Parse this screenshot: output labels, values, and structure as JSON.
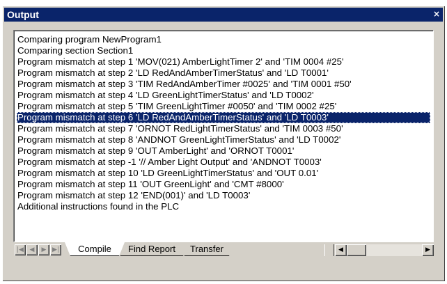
{
  "window": {
    "title": "Output",
    "close_glyph": "×"
  },
  "output": {
    "lines": [
      "Comparing program NewProgram1",
      "Comparing section Section1",
      "Program mismatch at step 1 'MOV(021) AmberLightTimer 2' and 'TIM 0004 #25'",
      "Program mismatch at step 2 'LD RedAndAmberTimerStatus' and 'LD T0001'",
      "Program mismatch at step 3 'TIM RedAndAmberTimer #0025' and 'TIM 0001 #50'",
      "Program mismatch at step 4 'LD GreenLightTimerStatus' and 'LD T0002'",
      "Program mismatch at step 5 'TIM GreenLightTimer #0050' and 'TIM 0002 #25'",
      "Program mismatch at step 6 'LD RedAndAmberTimerStatus' and 'LD T0003'",
      "Program mismatch at step 7 'ORNOT RedLightTimerStatus' and 'TIM 0003 #50'",
      "Program mismatch at step 8 'ANDNOT GreenLightTimerStatus' and 'LD T0002'",
      "Program mismatch at step 9 'OUT AmberLight' and 'ORNOT T0001'",
      "Program mismatch at step -1 '// Amber Light Output' and 'ANDNOT T0003'",
      "Program mismatch at step 10 'LD GreenLightTimerStatus' and 'OUT 0.01'",
      "Program mismatch at step 11 'OUT GreenLight' and 'CMT #8000'",
      "Program mismatch at step 12 'END(001)' and 'LD T0003'",
      "Additional instructions found in the PLC"
    ],
    "selected_index": 7
  },
  "tabs": [
    {
      "label": "Compile",
      "active": true
    },
    {
      "label": "Find Report",
      "active": false
    },
    {
      "label": "Transfer",
      "active": false
    }
  ],
  "nav_glyphs": {
    "first": "|◀",
    "prev": "◀",
    "next": "▶",
    "last": "▶|"
  },
  "scroll_glyphs": {
    "left": "◀",
    "right": "▶"
  },
  "colors": {
    "title_bg": "#0a246a",
    "selection_bg": "#0a246a",
    "face": "#d4d0c8"
  }
}
